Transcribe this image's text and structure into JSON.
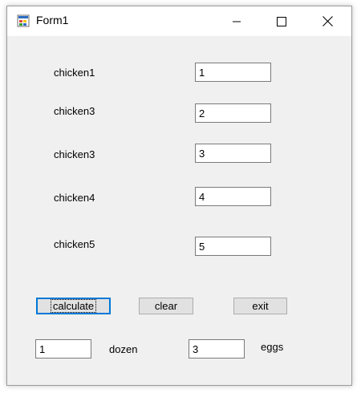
{
  "window": {
    "title": "Form1"
  },
  "caption": {
    "minimize": "minimize-icon",
    "maximize": "maximize-icon",
    "close": "close-icon"
  },
  "fields": [
    {
      "label": "chicken1",
      "value": "1"
    },
    {
      "label": "chicken3",
      "value": "2"
    },
    {
      "label": "chicken3",
      "value": "3"
    },
    {
      "label": "chicken4",
      "value": "4"
    },
    {
      "label": "chicken5",
      "value": "5"
    }
  ],
  "buttons": {
    "calculate": "calculate",
    "clear": "clear",
    "exit": "exit"
  },
  "results": {
    "dozen_value": "1",
    "dozen_label": "dozen",
    "eggs_value": "3",
    "eggs_label": "eggs"
  },
  "colors": {
    "window_bg": "#f0f0f0",
    "titlebar_bg": "#ffffff",
    "focus_border": "#0078d7"
  }
}
